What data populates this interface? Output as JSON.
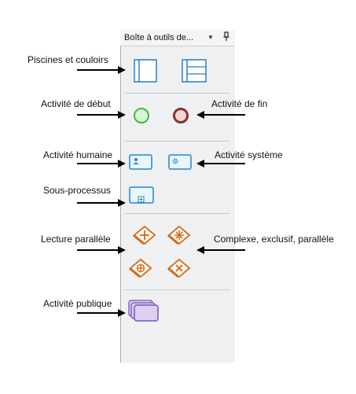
{
  "toolbox": {
    "title": "Boîte à outils de...",
    "dropdown_icon": "chevron-down-icon",
    "pin_icon": "pin-icon"
  },
  "labels": {
    "pools_lanes": "Piscines et couloirs",
    "start_activity": "Activité de début",
    "end_activity": "Activité de fin",
    "human_activity": "Activité humaine",
    "system_activity": "Activité système",
    "subprocess": "Sous-processus",
    "parallel_read": "Lecture parallèle",
    "complex_exclusive_parallel": "Complexe, exclusif, parallèle",
    "public_activity": "Activité publique"
  },
  "colors": {
    "start_green": "#3fb948",
    "end_red": "#8c2f2f",
    "activity_blue": "#1e88c9",
    "gateway_orange": "#d9731c",
    "public_purple": "#7a55b8"
  }
}
